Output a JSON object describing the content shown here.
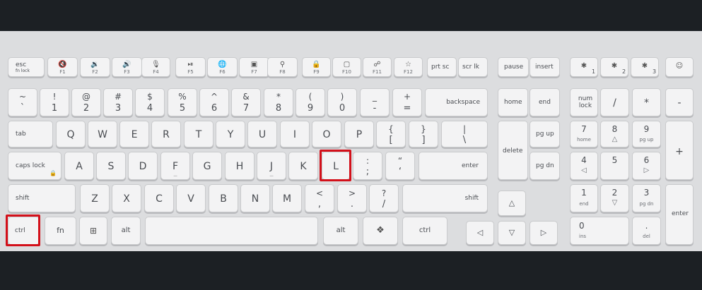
{
  "keys": {
    "esc": {
      "label": "esc",
      "sub": "fn lock"
    },
    "f1": {
      "sub": "F1"
    },
    "f2": {
      "sub": "F2"
    },
    "f3": {
      "sub": "F3"
    },
    "f4": {
      "sub": "F4"
    },
    "f5": {
      "sub": "F5"
    },
    "f6": {
      "sub": "F6"
    },
    "f7": {
      "sub": "F7"
    },
    "f8": {
      "sub": "F8"
    },
    "f9": {
      "sub": "F9"
    },
    "f10": {
      "sub": "F10"
    },
    "f11": {
      "sub": "F11"
    },
    "f12": {
      "sub": "F12"
    },
    "prtsc": "prt sc",
    "scrlk": "scr lk",
    "pause": "pause",
    "insert": "insert",
    "bt1": "1",
    "bt2": "2",
    "bt3": "3",
    "num_row": [
      {
        "top": "~",
        "bot": "`"
      },
      {
        "top": "!",
        "bot": "1"
      },
      {
        "top": "@",
        "bot": "2"
      },
      {
        "top": "#",
        "bot": "3"
      },
      {
        "top": "$",
        "bot": "4"
      },
      {
        "top": "%",
        "bot": "5"
      },
      {
        "top": "^",
        "bot": "6"
      },
      {
        "top": "&",
        "bot": "7"
      },
      {
        "top": "*",
        "bot": "8"
      },
      {
        "top": "(",
        "bot": "9"
      },
      {
        "top": ")",
        "bot": "0"
      },
      {
        "top": "_",
        "bot": "-"
      },
      {
        "top": "+",
        "bot": "="
      }
    ],
    "backspace": "backspace",
    "tab": "tab",
    "row_q": [
      "Q",
      "W",
      "E",
      "R",
      "T",
      "Y",
      "U",
      "I",
      "O",
      "P"
    ],
    "bracket_l": {
      "top": "{",
      "bot": "["
    },
    "bracket_r": {
      "top": "}",
      "bot": "]"
    },
    "backslash": {
      "top": "|",
      "bot": "\\"
    },
    "capslock": "caps lock",
    "row_a": [
      "A",
      "S",
      "D",
      "F",
      "G",
      "H",
      "J",
      "K",
      "L"
    ],
    "semicolon": {
      "top": ":",
      "bot": ";"
    },
    "quote": {
      "top": "“",
      "bot": "‘"
    },
    "enter": "enter",
    "shift_l": "shift",
    "row_z": [
      "Z",
      "X",
      "C",
      "V",
      "B",
      "N",
      "M"
    ],
    "comma": {
      "top": "<",
      "bot": ","
    },
    "period": {
      "top": ">",
      "bot": "."
    },
    "slash": {
      "top": "?",
      "bot": "/"
    },
    "shift_r": "shift",
    "ctrl_l": "ctrl",
    "fn": "fn",
    "alt_l": "alt",
    "alt_r": "alt",
    "ctrl_r": "ctrl",
    "home": "home",
    "end": "end",
    "delete": "delete",
    "pgup": "pg up",
    "pgdn": "pg dn",
    "numlock": "num lock",
    "num_div": "/",
    "num_mul": "*",
    "num_sub": "-",
    "num_add": "+",
    "num7": {
      "top": "7",
      "bot": "home"
    },
    "num8": {
      "top": "8",
      "bot": "△"
    },
    "num9": {
      "top": "9",
      "bot": "pg up"
    },
    "num4": {
      "top": "4",
      "bot": "◁"
    },
    "num5": {
      "top": "5",
      "bot": ""
    },
    "num6": {
      "top": "6",
      "bot": "▷"
    },
    "num1": {
      "top": "1",
      "bot": "end"
    },
    "num2": {
      "top": "2",
      "bot": "▽"
    },
    "num3": {
      "top": "3",
      "bot": "pg dn"
    },
    "num0": {
      "top": "0",
      "bot": "ins"
    },
    "numdot": {
      "top": ".",
      "bot": "del"
    },
    "num_enter": "enter",
    "arrow_up": "△",
    "arrow_left": "◁",
    "arrow_down": "▽",
    "arrow_right": "▷"
  },
  "colors": {
    "highlight": "#d3101a",
    "background": "#1c2024",
    "keyboard": "#dcdddf",
    "key": "#f3f3f4"
  }
}
